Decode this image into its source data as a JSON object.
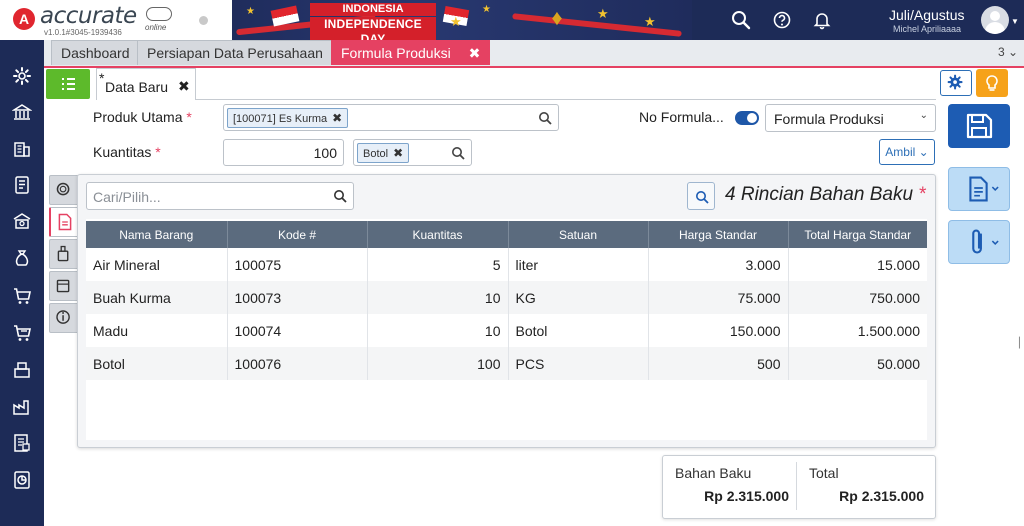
{
  "app": {
    "logo_letter": "A",
    "logo_text": "accurate",
    "logo_online": "online",
    "version": "v1.0.1#3045-1939436"
  },
  "banner": {
    "line1": "INDONESIA",
    "line2": "INDEPENDENCE DAY"
  },
  "user": {
    "period": "Juli/Agustus",
    "name": "Michel Apriliaaaa"
  },
  "module_tabs": [
    {
      "label": "Dashboard"
    },
    {
      "label": "Persiapan Data Perusahaan"
    },
    {
      "label": "Formula Produksi",
      "close": "✖"
    }
  ],
  "tab_count": "3 ⌄",
  "doc_tab": {
    "star": "*",
    "label": "Data Baru",
    "close": "✖"
  },
  "form": {
    "produk_utama_label": "Produk Utama",
    "produk_utama_value": "[100071] Es Kurma",
    "kuantitas_label": "Kuantitas",
    "kuantitas_value": "100",
    "unit_value": "Botol",
    "required_mark": "*",
    "no_formula_label": "No Formula...",
    "no_formula_toggle": true,
    "formula_select": "Formula Produksi",
    "ambil_label": "Ambil ⌄"
  },
  "details": {
    "search_placeholder": "Cari/Pilih...",
    "title": "4 Rincian Bahan Baku",
    "columns": [
      "Nama Barang",
      "Kode #",
      "Kuantitas",
      "Satuan",
      "Harga Standar",
      "Total Harga Standar"
    ],
    "rows": [
      {
        "nama": "Air Mineral",
        "kode": "100075",
        "qty": "5",
        "satuan": "liter",
        "harga": "3.000",
        "total": "15.000"
      },
      {
        "nama": "Buah Kurma",
        "kode": "100073",
        "qty": "10",
        "satuan": "KG",
        "harga": "75.000",
        "total": "750.000"
      },
      {
        "nama": "Madu",
        "kode": "100074",
        "qty": "10",
        "satuan": "Botol",
        "harga": "150.000",
        "total": "1.500.000"
      },
      {
        "nama": "Botol",
        "kode": "100076",
        "qty": "100",
        "satuan": "PCS",
        "harga": "500",
        "total": "50.000"
      }
    ]
  },
  "totals": {
    "bahan_baku_label": "Bahan Baku",
    "bahan_baku_value": "Rp 2.315.000",
    "total_label": "Total",
    "total_value": "Rp 2.315.000"
  },
  "colors": {
    "accent": "#e54162",
    "navy": "#1d2b57",
    "primary": "#1d5cb3",
    "success": "#5dba2b",
    "warning": "#f6a21a"
  }
}
